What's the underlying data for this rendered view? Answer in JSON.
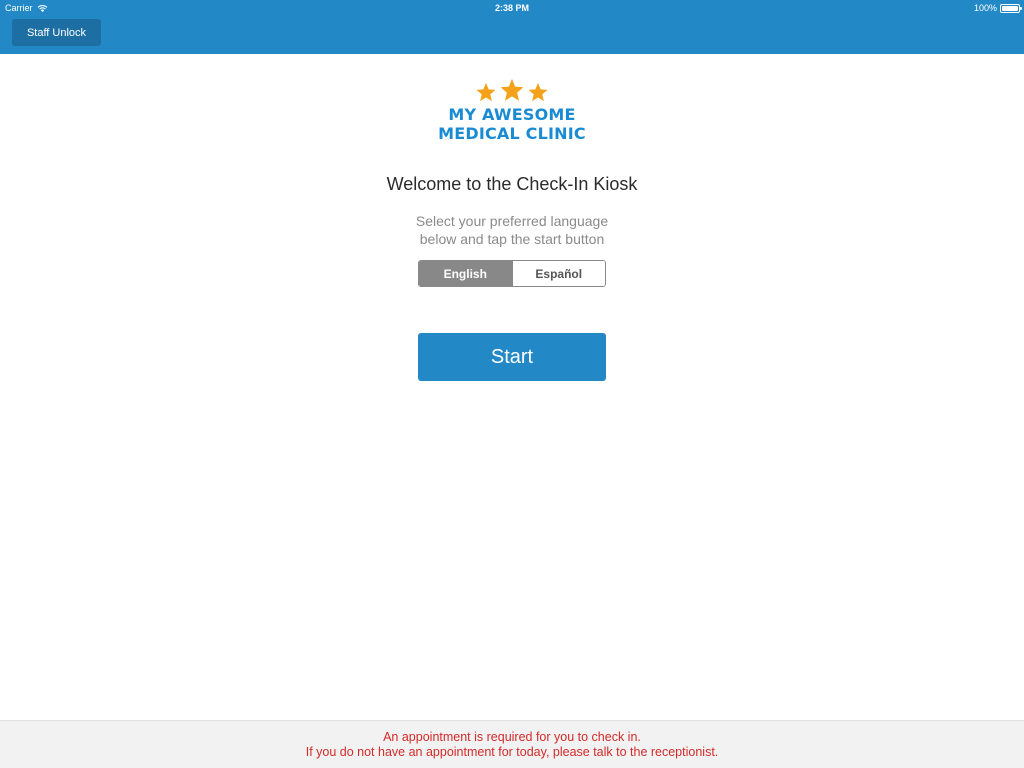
{
  "status_bar": {
    "carrier": "Carrier",
    "time": "2:38 PM",
    "battery": "100%",
    "battery_level": 1.0,
    "wifi_icon": "wifi-icon",
    "battery_icon": "battery-icon"
  },
  "header": {
    "staff_unlock_label": "Staff Unlock"
  },
  "logo": {
    "star_count": 3,
    "line1": "MY AWESOME",
    "line2": "MEDICAL CLINIC"
  },
  "main": {
    "welcome": "Welcome to the Check-In Kiosk",
    "instructions_line1": "Select your preferred language",
    "instructions_line2": "below and tap the start button",
    "languages": [
      {
        "label": "English",
        "selected": true
      },
      {
        "label": "Español",
        "selected": false
      }
    ],
    "start_label": "Start"
  },
  "footer": {
    "line1": "An appointment is required for you to check in.",
    "line2": "If you do not have an appointment for today, please talk to the receptionist."
  },
  "colors": {
    "header_bg": "#2289c6",
    "staff_unlock_bg": "#1c6ea3",
    "logo_text": "#1a8bd3",
    "star": "#f5a21b",
    "footer_text": "#d42a2a",
    "footer_bg": "#f2f2f2",
    "segment_selected": "#888888"
  }
}
